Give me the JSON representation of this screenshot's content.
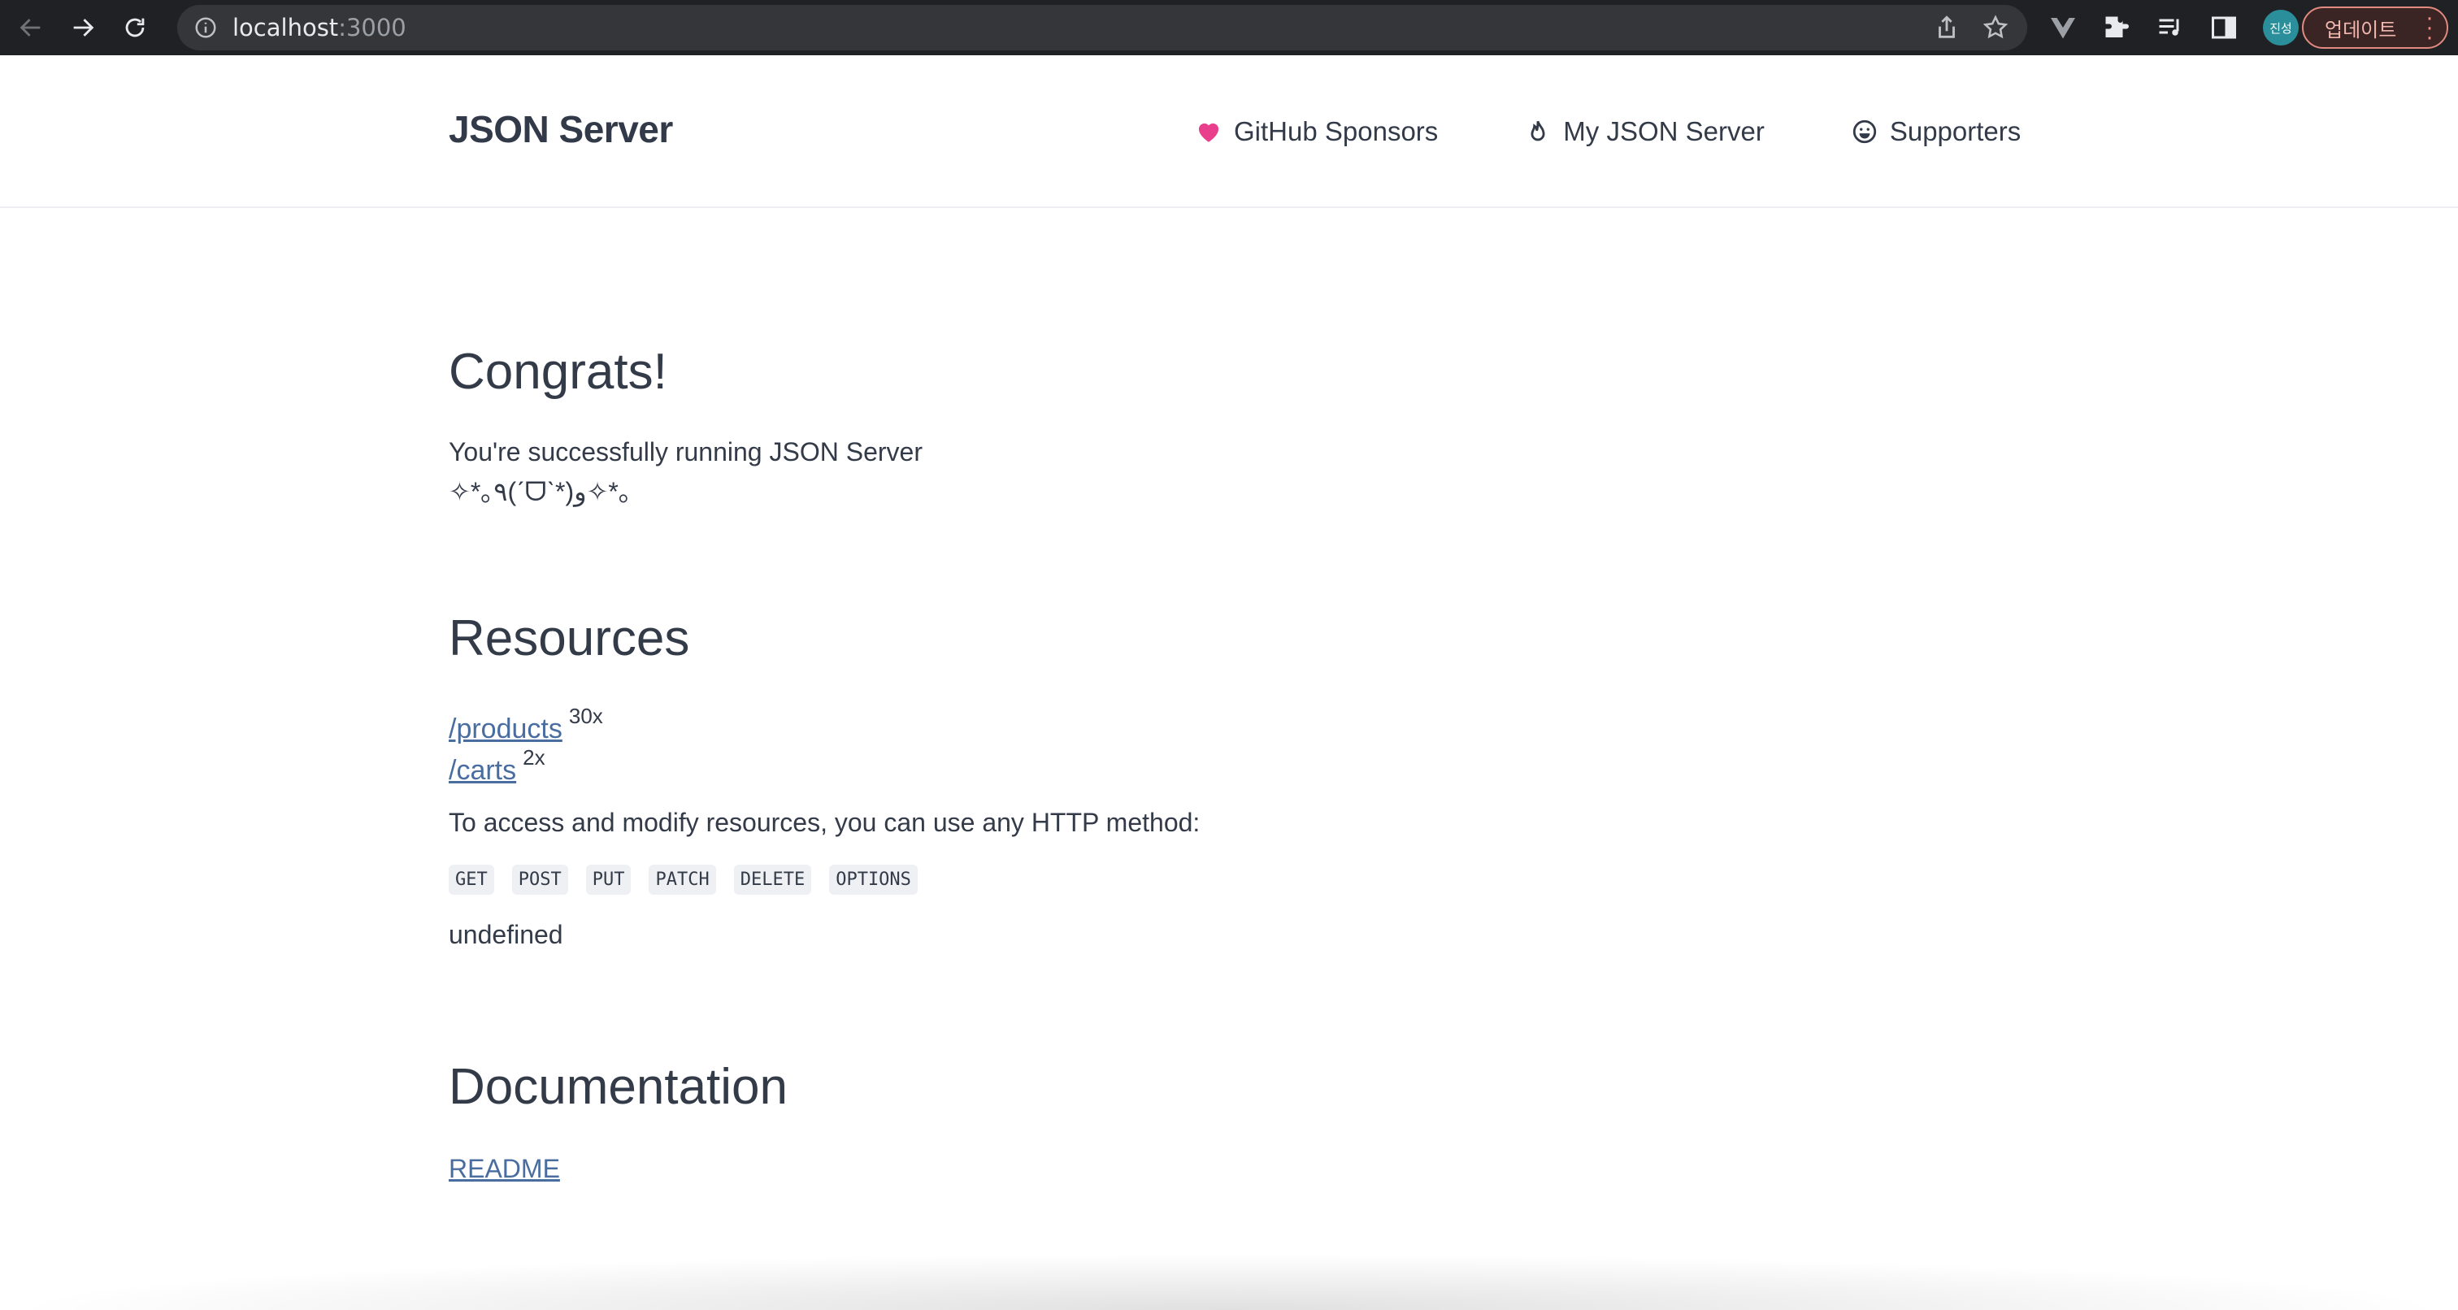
{
  "browser": {
    "url_host": "localhost",
    "url_port": ":3000",
    "profile_initials": "진성",
    "update_label": "업데이트"
  },
  "header": {
    "brand": "JSON Server",
    "nav": [
      {
        "label": "GitHub Sponsors",
        "icon": "heart-icon"
      },
      {
        "label": "My JSON Server",
        "icon": "flame-icon"
      },
      {
        "label": "Supporters",
        "icon": "smile-icon"
      }
    ]
  },
  "congrats": {
    "title": "Congrats!",
    "line1": "You're successfully running JSON Server",
    "line2": "✧*｡٩(ˊᗜˋ*)و✧*｡"
  },
  "resources": {
    "title": "Resources",
    "items": [
      {
        "path": "/products",
        "count": "30x"
      },
      {
        "path": "/carts",
        "count": "2x"
      }
    ],
    "access_text": "To access and modify resources, you can use any HTTP method:",
    "methods": [
      "GET",
      "POST",
      "PUT",
      "PATCH",
      "DELETE",
      "OPTIONS"
    ],
    "extra": "undefined"
  },
  "documentation": {
    "title": "Documentation",
    "readme": "README"
  },
  "colors": {
    "accent_heart": "#e83e8c",
    "link": "#4a6da0",
    "text": "#333a48"
  }
}
